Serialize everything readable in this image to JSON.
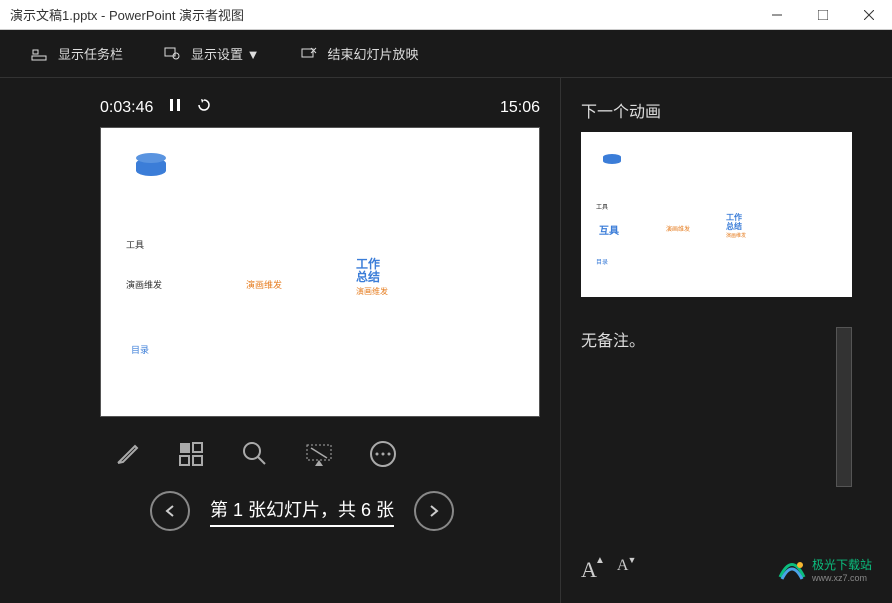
{
  "titlebar": {
    "title": "演示文稿1.pptx - PowerPoint 演示者视图"
  },
  "toolbar": {
    "show_taskbar": "显示任务栏",
    "display_settings": "显示设置 ▼",
    "end_slideshow": "结束幻灯片放映"
  },
  "timer": {
    "elapsed": "0:03:46",
    "current_time": "15:06"
  },
  "slide_content": {
    "text1": "工具",
    "text2": "演画维发",
    "text3": "演画维发",
    "text4": "工作\n总结",
    "text5": "演画维发",
    "text6": "目录"
  },
  "navigation": {
    "slide_counter": "第 1 张幻灯片，共 6 张"
  },
  "side": {
    "next_animation": "下一个动画",
    "no_notes": "无备注。"
  },
  "next_slide_content": {
    "text1": "工具",
    "text2": "互具",
    "text3": "演画维发",
    "text4": "工作\n总结",
    "text5": "演画维发",
    "text6": "目录"
  },
  "font_controls": {
    "increase": "A",
    "decrease": "A"
  },
  "watermark": {
    "text": "极光下载站",
    "url": "www.xz7.com"
  }
}
